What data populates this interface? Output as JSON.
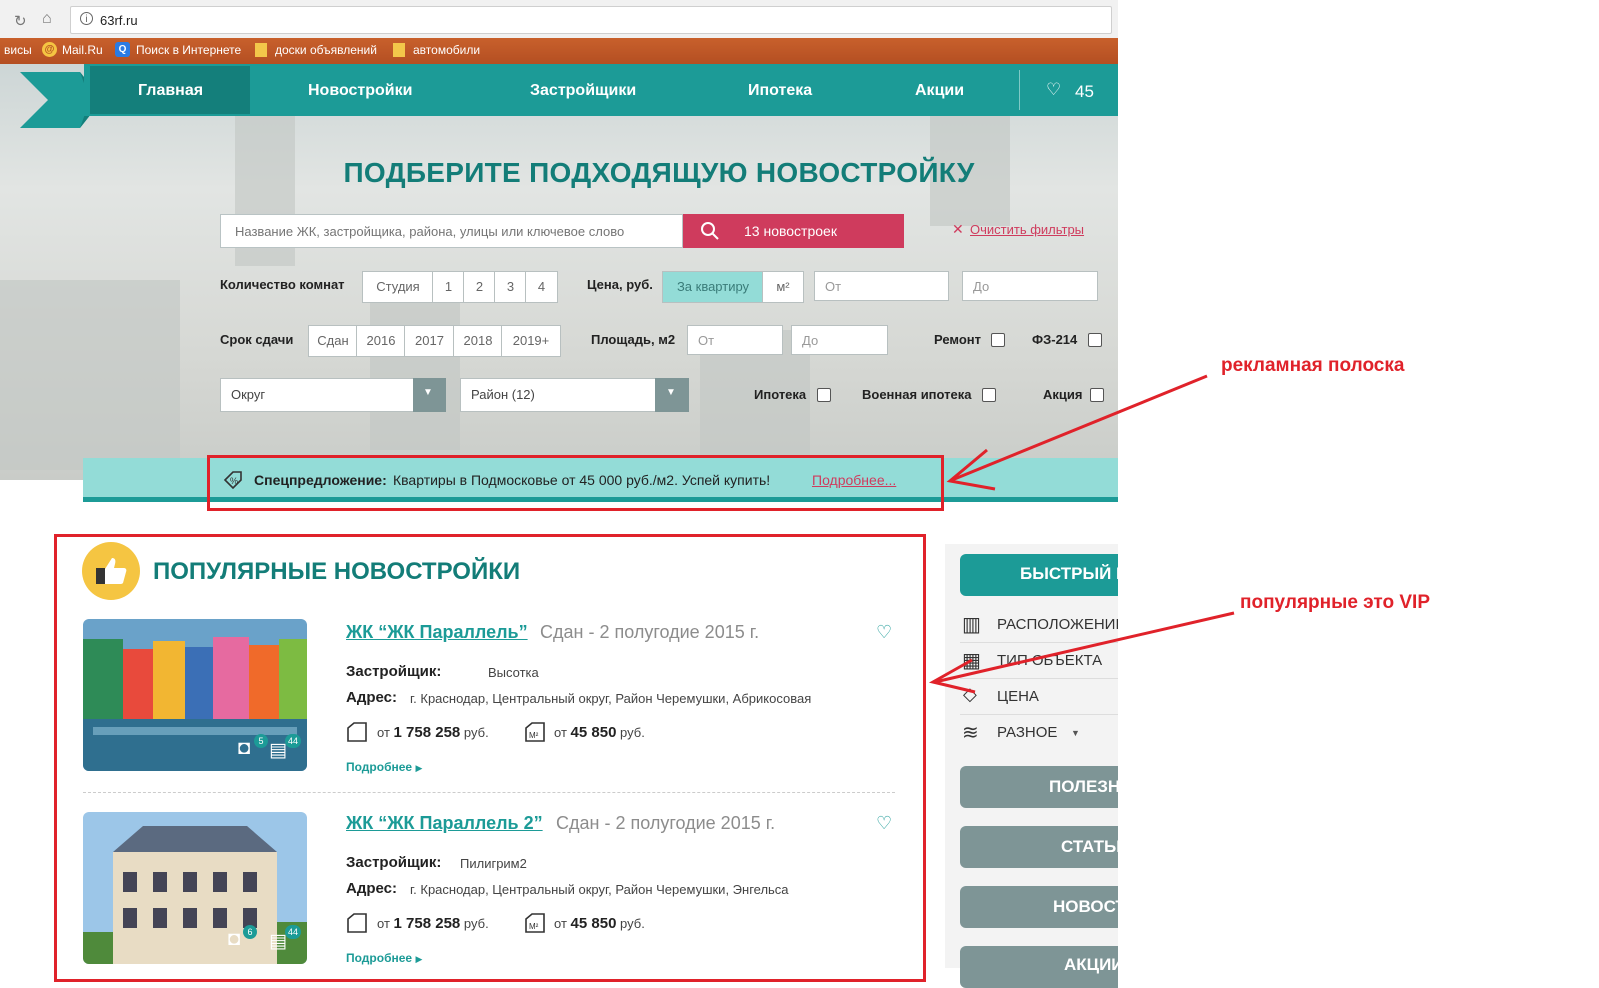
{
  "browser": {
    "url": "63rf.ru",
    "bookmarks": [
      "висы",
      "Mail.Ru",
      "Поиск в Интернете",
      "доски объявлений",
      "автомобили"
    ]
  },
  "nav": {
    "items": [
      "Главная",
      "Новостройки",
      "Застройщики",
      "Ипотека",
      "Акции"
    ],
    "favorites_count": "45"
  },
  "hero": {
    "headline": "ПОДБЕРИТЕ ПОДХОДЯЩУЮ НОВОСТРОЙКУ",
    "search_placeholder": "Название ЖК, застройщика, района, улицы или ключевое слово",
    "search_button": "13 новостроек",
    "clear_filters": "Очистить фильтры"
  },
  "filters": {
    "rooms_label": "Количество комнат",
    "rooms": [
      "Студия",
      "1",
      "2",
      "3",
      "4"
    ],
    "price_label": "Цена, руб.",
    "price_per_flat": "За квартиру",
    "price_per_m2": "м²",
    "from": "От",
    "to": "До",
    "deadline_label": "Срок сдачи",
    "deadlines": [
      "Сдан",
      "2016",
      "2017",
      "2018",
      "2019+"
    ],
    "area_label": "Площадь, м2",
    "repair": "Ремонт",
    "fz214": "ФЗ-214",
    "okrug": "Округ",
    "rayon": "Район (12)",
    "ipoteka": "Ипотека",
    "military": "Военная ипотека",
    "aktsiya": "Акция"
  },
  "promo": {
    "bold": "Спецпредложение:",
    "text": "Квартиры в Подмосковье от 45 000 руб./м2. Успей купить!",
    "link": "Подробнее..."
  },
  "popular": {
    "title": "ПОПУЛЯРНЫЕ НОВОСТРОЙКИ",
    "listings": [
      {
        "title": "ЖК “ЖК Параллель”",
        "status": "Сдан - 2 полугодие 2015 г.",
        "developer_label": "Застройщик:",
        "developer": "Высотка",
        "address_label": "Адрес:",
        "address": "г. Краснодар, Центральный округ, Район Черемушки, Абрикосовая",
        "price_from_label": "от",
        "price_total": "1 758 258",
        "price_m2": "45 850",
        "currency": "руб.",
        "photos": "5",
        "comments": "44",
        "more": "Подробнее"
      },
      {
        "title": "ЖК “ЖК Параллель 2”",
        "status": "Сдан - 2 полугодие 2015 г.",
        "developer_label": "Застройщик:",
        "developer": "Пилигрим2",
        "address_label": "Адрес:",
        "address": "г. Краснодар, Центральный округ, Район Черемушки, Энгельса",
        "price_from_label": "от",
        "price_total": "1 758 258",
        "price_m2": "45 850",
        "currency": "руб.",
        "photos": "6",
        "comments": "44",
        "more": "Подробнее"
      }
    ]
  },
  "sidebar": {
    "quick_search": "БЫСТРЫЙ ПО",
    "items": [
      "РАСПОЛОЖЕНИЕ",
      "ТИП ОБЪЕКТА",
      "ЦЕНА",
      "РАЗНОЕ"
    ],
    "buttons": [
      "ПОЛЕЗНО",
      "СТАТЬИ",
      "НОВОСТ",
      "АКЦИИ"
    ]
  },
  "annotations": {
    "ad_strip": "рекламная полоска",
    "popular_vip": "популярные это VIP"
  },
  "colors": {
    "teal": "#1c9b97",
    "teal_dark": "#147f7b",
    "search_red": "#cf3b5d",
    "annotation_red": "#e0222a"
  }
}
